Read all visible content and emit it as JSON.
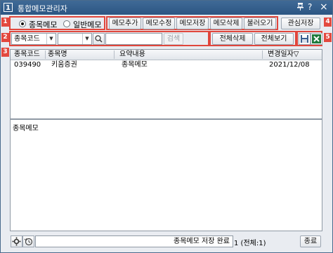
{
  "window": {
    "app_icon": "1",
    "title": "통합메모관리자",
    "pin_icon": "pin-icon",
    "help_label": "?",
    "close_label": "×"
  },
  "callouts": [
    "1",
    "2",
    "3",
    "4",
    "5"
  ],
  "accent_color": "#e0463c",
  "title_color": "#2c5683",
  "memo_type": {
    "options": [
      "종목메모",
      "일반메모"
    ],
    "selected": "종목메모"
  },
  "toolbar": {
    "add_label": "메모추가",
    "edit_label": "메모수정",
    "save_label": "메모저장",
    "delete_label": "메모삭제",
    "load_label": "불러오기",
    "watchlist_save_label": "관심저장"
  },
  "search": {
    "type_value": "종목코드",
    "code_value": "",
    "name_value": "",
    "search_label": "검색"
  },
  "actions": {
    "delete_all_label": "전체삭제",
    "view_all_label": "전체보기"
  },
  "table": {
    "columns": [
      "종목코드",
      "종목명",
      "요약내용",
      "변경일자▽"
    ],
    "rows": [
      {
        "code": "039490",
        "name": "키움증권",
        "summary": "종목메모",
        "date": "2021/12/08"
      }
    ]
  },
  "memo_content": "종목메모",
  "status": {
    "message": "종목메모 저장 완료",
    "count_text": "1 (전체:1)",
    "close_label": "종료"
  }
}
